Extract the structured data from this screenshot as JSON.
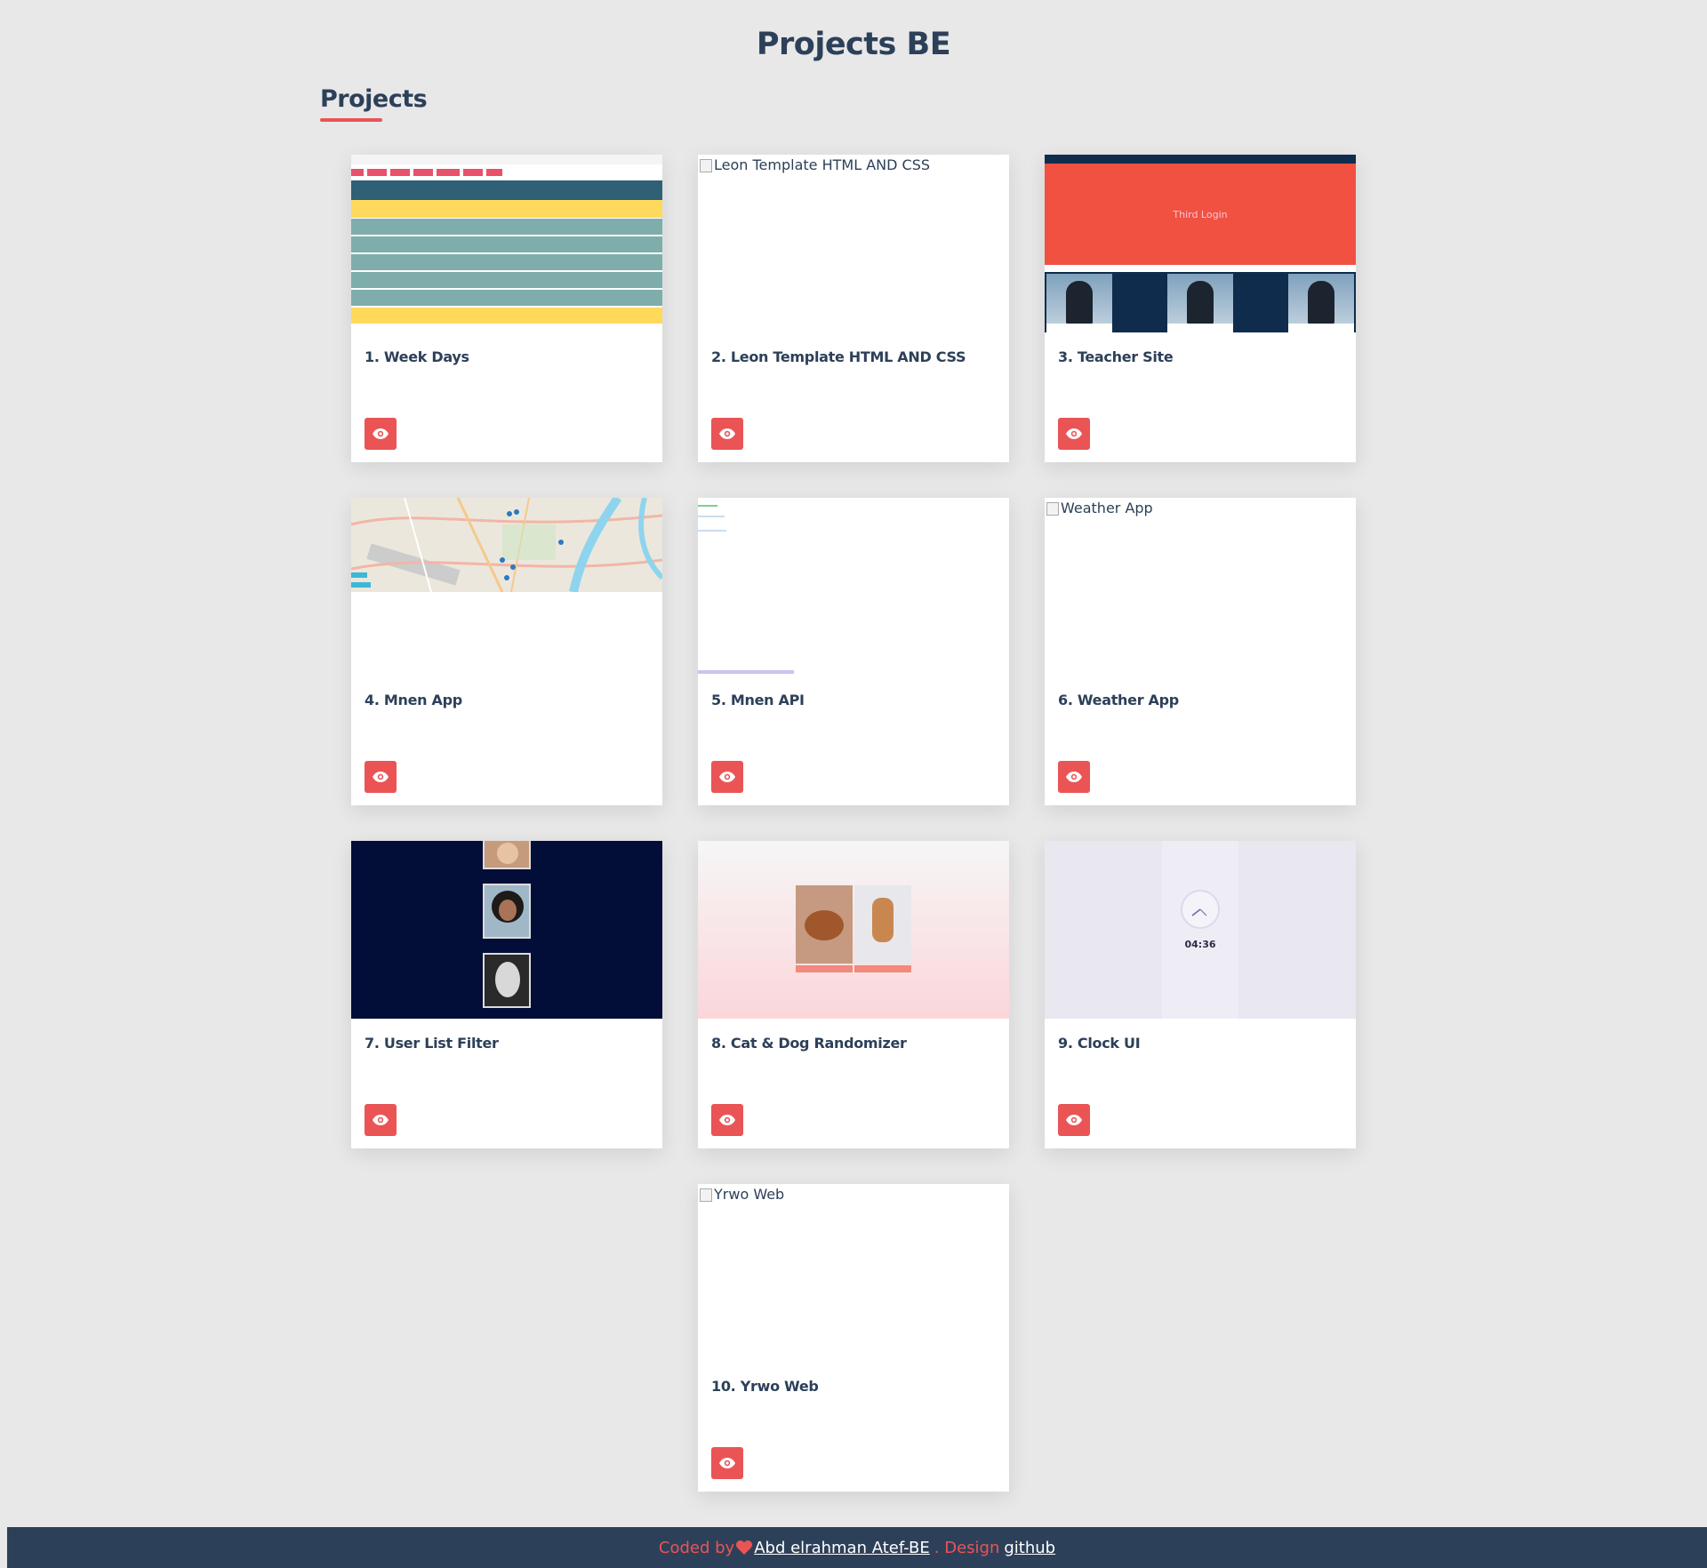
{
  "header": {
    "site_title": "Projects BE",
    "section_title": "Projects"
  },
  "projects": [
    {
      "title": "1. Week Days",
      "thumb": "week-days"
    },
    {
      "title": "2. Leon Template HTML AND CSS",
      "thumb": "broken",
      "alt": "Leon Template HTML AND CSS"
    },
    {
      "title": "3. Teacher Site",
      "thumb": "teacher",
      "caption": "Third Login"
    },
    {
      "title": "4. Mnen App",
      "thumb": "map"
    },
    {
      "title": "5. Mnen API",
      "thumb": "api"
    },
    {
      "title": "6. Weather App",
      "thumb": "broken",
      "alt": "Weather App"
    },
    {
      "title": "7. User List Filter",
      "thumb": "users"
    },
    {
      "title": "8. Cat & Dog Randomizer",
      "thumb": "catdog"
    },
    {
      "title": "9. Clock UI",
      "thumb": "clock",
      "time": "04:36"
    },
    {
      "title": "10. Yrwo Web",
      "thumb": "broken",
      "alt": "Yrwo Web"
    }
  ],
  "footer": {
    "coded_by": "Coded by",
    "author": "Abd elrahman Atef-BE",
    "design": ". Design",
    "github": "github"
  },
  "colors": {
    "accent": "#ea5455",
    "primary": "#2d4059",
    "background": "#e8e8e8"
  },
  "icons": {
    "view": "eye-icon",
    "heart": "heart-icon"
  }
}
